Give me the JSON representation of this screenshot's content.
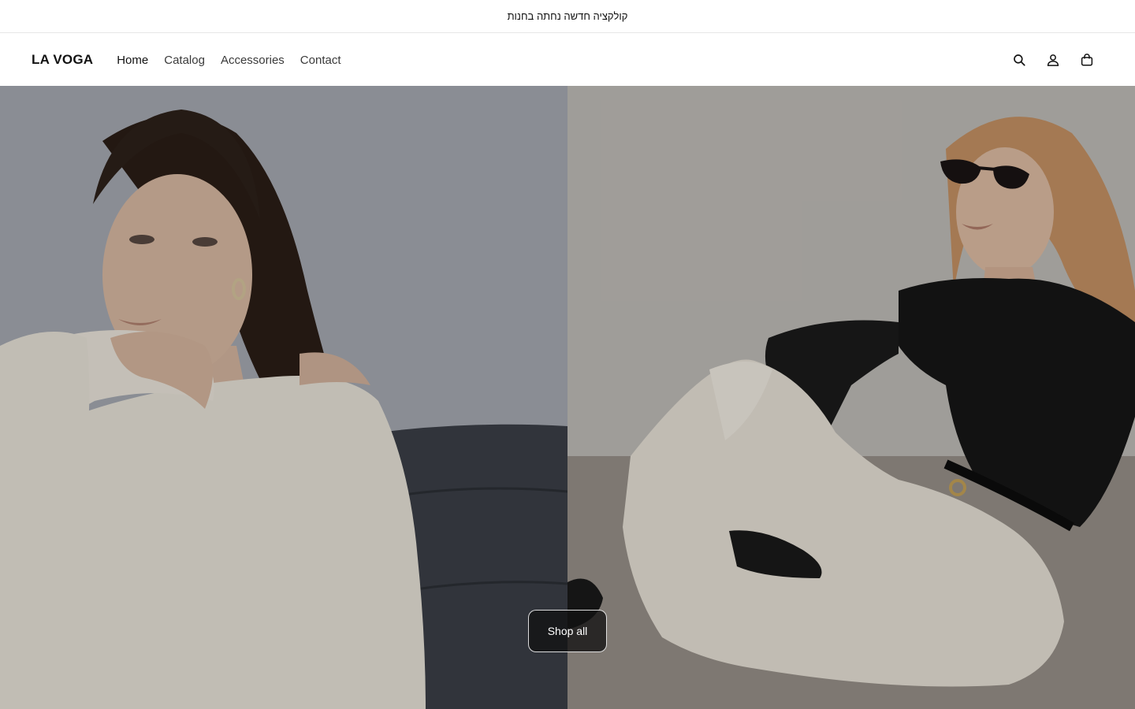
{
  "announcement": {
    "text": "קולקציה חדשה נחתה בחנות"
  },
  "header": {
    "logo": "LA VOGA",
    "nav": [
      {
        "label": "Home"
      },
      {
        "label": "Catalog"
      },
      {
        "label": "Accessories"
      },
      {
        "label": "Contact"
      }
    ],
    "icons": [
      "search-icon",
      "account-icon",
      "cart-icon"
    ]
  },
  "hero": {
    "cta_label": "Shop all",
    "left_image": "model seated in cream off-shoulder top, hand under chin, on dark leather sofa",
    "right_image": "model in black top, sunglasses and cream trousers seated on floor"
  },
  "colors": {
    "text": "#121212",
    "border": "#e6e6e6",
    "button_bg": "#121212"
  }
}
